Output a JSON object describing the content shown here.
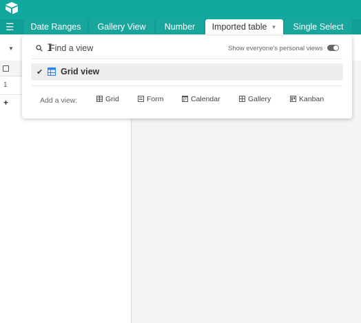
{
  "header": {
    "tabs": [
      {
        "label": "Date Ranges",
        "active": false
      },
      {
        "label": "Gallery View",
        "active": false
      },
      {
        "label": "Number",
        "active": false
      },
      {
        "label": "Imported table",
        "active": true
      },
      {
        "label": "Single Select",
        "active": false
      }
    ]
  },
  "grid": {
    "row_number": "1",
    "add_row": "+"
  },
  "view_popup": {
    "search_placeholder": "Find a view",
    "toggle_label": "Show everyone's personal views",
    "toggle_on": true,
    "views": [
      {
        "label": "Grid view",
        "selected": true,
        "icon": "grid-icon"
      }
    ],
    "add_view_label": "Add a view:",
    "add_view_options": [
      {
        "label": "Grid",
        "icon": "grid-icon"
      },
      {
        "label": "Form",
        "icon": "form-icon"
      },
      {
        "label": "Calendar",
        "icon": "calendar-icon"
      },
      {
        "label": "Gallery",
        "icon": "gallery-icon"
      },
      {
        "label": "Kanban",
        "icon": "kanban-icon"
      }
    ]
  },
  "colors": {
    "header_teal": "#13a89e",
    "tab_bg": "#19a69c",
    "grid_icon_blue": "#2d7ff9"
  }
}
